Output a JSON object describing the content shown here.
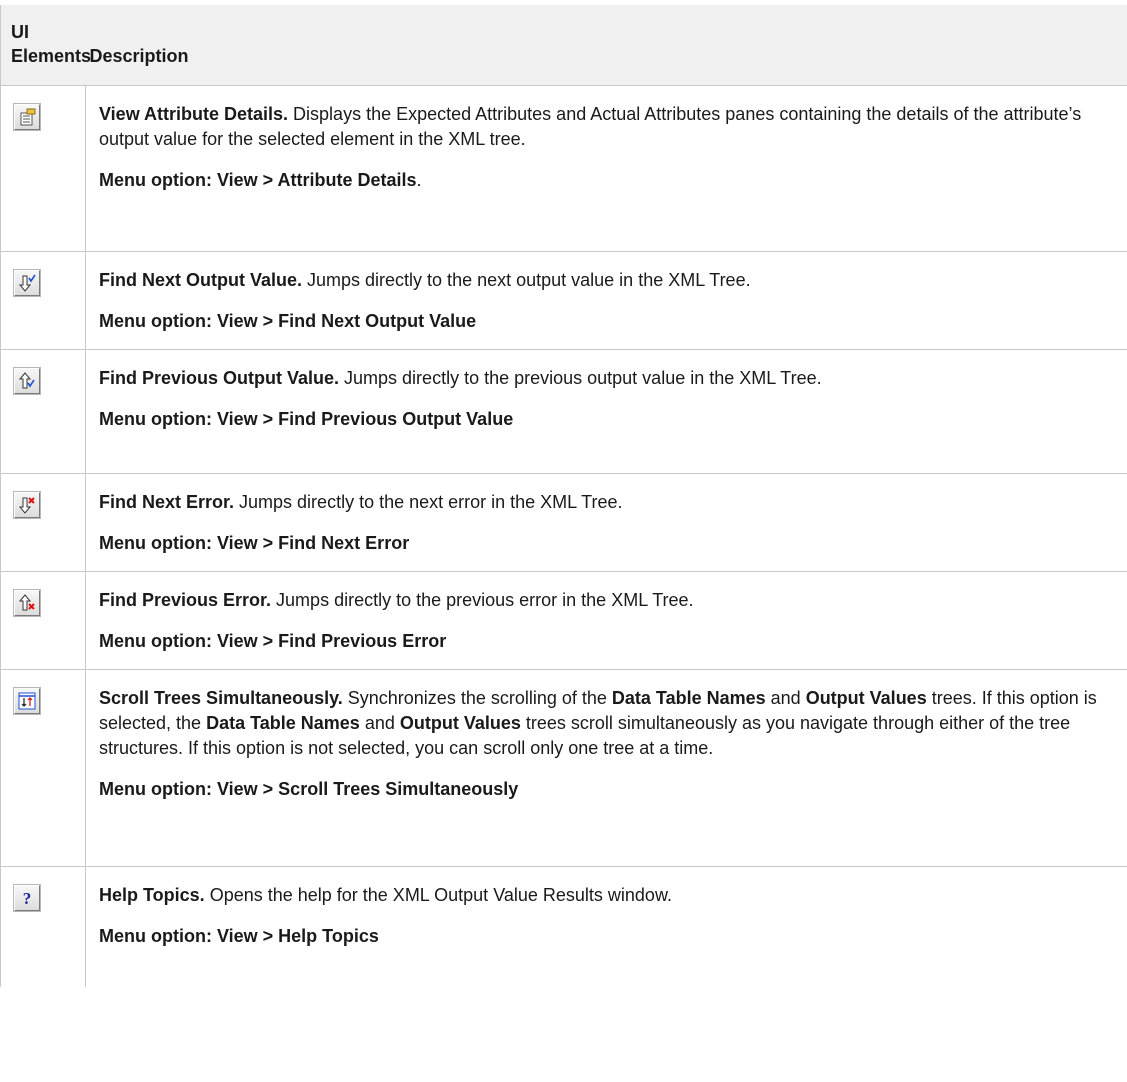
{
  "header": {
    "col1": "UI Elements",
    "col2": "Description"
  },
  "rows": [
    {
      "icon": "attribute-details-icon",
      "title": "View Attribute Details.",
      "text": " Displays the Expected Attributes and Actual Attributes panes containing the details of the attribute’s output value for the selected element in the XML tree.",
      "menu": "Menu option: View > Attribute Details",
      "menu_suffix": "."
    },
    {
      "icon": "find-next-output-value-icon",
      "title": "Find Next Output Value.",
      "text": " Jumps directly to the next output value in the XML Tree.",
      "menu": "Menu option: View > Find Next Output Value",
      "menu_suffix": ""
    },
    {
      "icon": "find-previous-output-value-icon",
      "title": "Find Previous Output Value.",
      "text": " Jumps directly to the previous output value in the XML Tree.",
      "menu": "Menu option: View > Find Previous Output Value",
      "menu_suffix": ""
    },
    {
      "icon": "find-next-error-icon",
      "title": "Find Next Error.",
      "text": " Jumps directly to the next error in the XML Tree.",
      "menu": "Menu option: View > Find Next Error",
      "menu_suffix": ""
    },
    {
      "icon": "find-previous-error-icon",
      "title": "Find Previous Error.",
      "text": " Jumps directly to the previous error in the XML Tree.",
      "menu": "Menu option: View > Find Previous Error",
      "menu_suffix": ""
    },
    {
      "icon": "scroll-trees-simultaneously-icon",
      "title": "Scroll Trees Simultaneously.",
      "parts": [
        " Synchronizes the scrolling of the ",
        "Data Table Names",
        " and ",
        "Output Values",
        " trees. If this option is selected, the ",
        "Data Table Names",
        " and ",
        "Output Values",
        " trees scroll simultaneously as you navigate through either of the tree structures. If this option is not selected, you can scroll only one tree at a time."
      ],
      "menu": "Menu option: View > Scroll Trees Simultaneously",
      "menu_suffix": ""
    },
    {
      "icon": "help-topics-icon",
      "title": "Help Topics.",
      "text": " Opens the help for the XML Output Value Results window.",
      "menu": "Menu option: View > Help Topics",
      "menu_suffix": ""
    }
  ]
}
